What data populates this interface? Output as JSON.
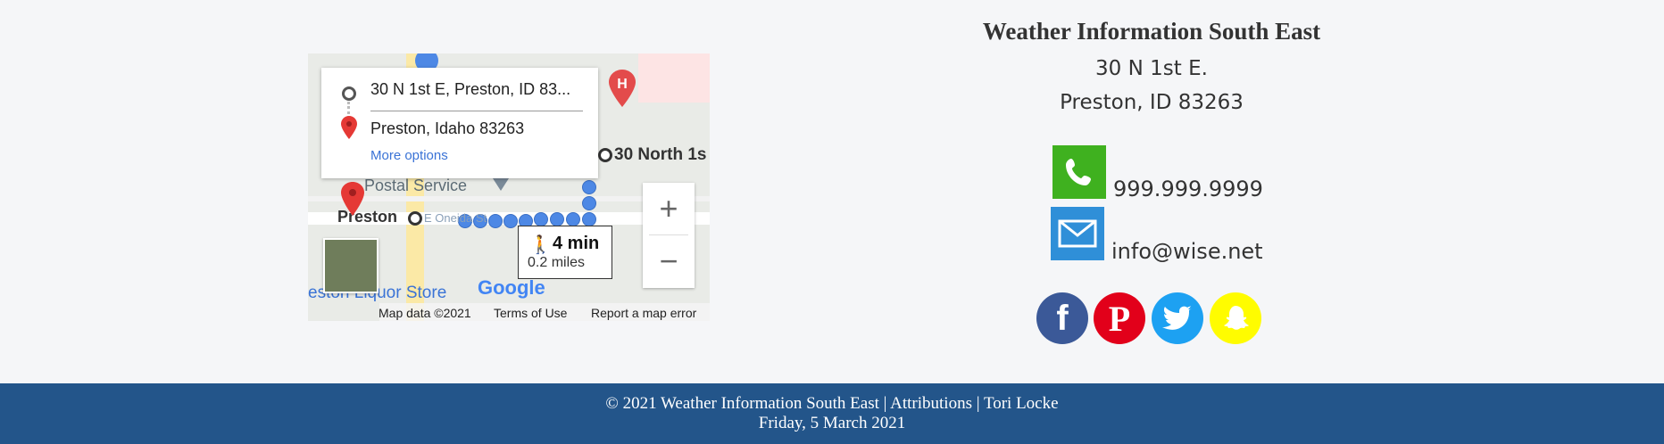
{
  "map": {
    "origin": "30 N 1st E, Preston, ID 83...",
    "destination": "Preston, Idaho 83263",
    "more_options": "More options",
    "walk_time": "4 min",
    "walk_distance": "0.2 miles",
    "labels": {
      "postal": "Postal Service",
      "preston": "Preston",
      "street": "E Oneida St",
      "north": "30 North 1s",
      "liquor": "eston Liquor Store",
      "google": "Google"
    },
    "zoom_in": "+",
    "zoom_out": "−",
    "attribution": {
      "data": "Map data ©2021",
      "terms": "Terms of Use",
      "report": "Report a map error"
    }
  },
  "info": {
    "title": "Weather Information South East",
    "address_line1": "30 N 1st E.",
    "address_line2": "Preston, ID 83263",
    "phone": "999.999.9999",
    "email": "info@wise.net"
  },
  "social": [
    "facebook-icon",
    "pinterest-icon",
    "twitter-icon",
    "snapchat-icon"
  ],
  "colors": {
    "footer_bg": "#23558a",
    "phone_bg": "#3fb11f",
    "email_bg": "#2f8fd8",
    "facebook": "#3b5998",
    "pinterest": "#e2001a",
    "twitter": "#1da1f2",
    "snapchat": "#fffc00"
  },
  "footer": {
    "line1": "© 2021 Weather Information South East | Attributions | Tori Locke",
    "line2": "Friday, 5 March 2021"
  }
}
